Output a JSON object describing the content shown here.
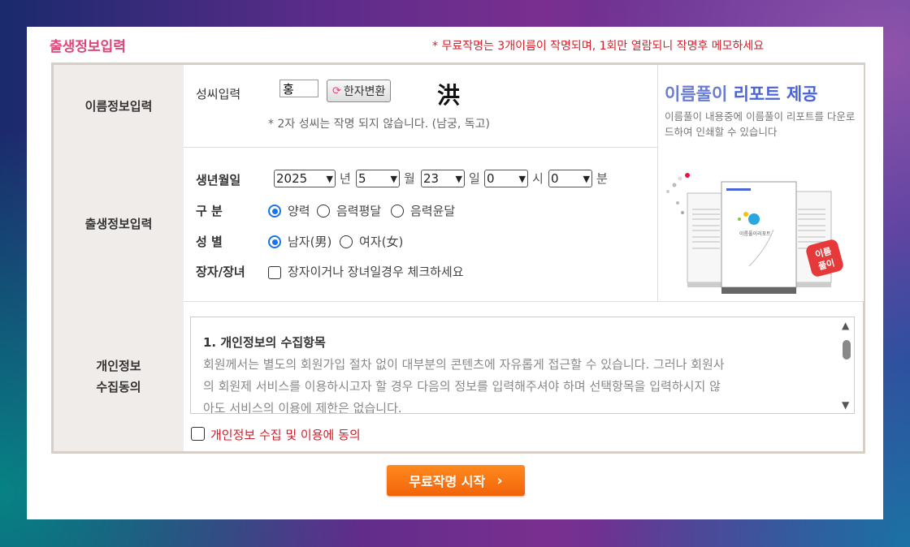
{
  "header": {
    "title": "출생정보입력",
    "note": "* 무료작명는 3개이름이 작명되며, 1회만 열람되니 작명후 메모하세요"
  },
  "name_section": {
    "label": "이름정보입력",
    "surname_label": "성씨입력",
    "surname_value": "홍",
    "hanja_button": "한자변환",
    "hanja_char": "洪",
    "note": "* 2자 성씨는 작명 되지 않습니다. (남궁, 독고)"
  },
  "birth_section": {
    "label": "출생정보입력",
    "date_label": "생년월일",
    "year": "2025",
    "year_unit": "년",
    "month": "5",
    "month_unit": "월",
    "day": "23",
    "day_unit": "일",
    "hour": "0",
    "hour_unit": "시",
    "minute": "0",
    "minute_unit": "분",
    "calendar_label": "구 분",
    "calendar_options": [
      "양력",
      "음력평달",
      "음력윤달"
    ],
    "calendar_selected": "양력",
    "gender_label": "성 별",
    "gender_options": [
      "남자(男)",
      "여자(女)"
    ],
    "gender_selected": "남자(男)",
    "eldest_label": "장자/장녀",
    "eldest_checkbox": "장자이거나 장녀일경우 체크하세요"
  },
  "ad": {
    "title_part1": "이름풀이",
    "title_part2": "리포트 제공",
    "desc": "이름풀이 내용중에 이름풀이 리포트를 다운로드하여 인쇄할 수 있습니다",
    "badge_top": "이름",
    "badge_bottom": "풀이",
    "doc_title": "이름풀이리포트"
  },
  "privacy_section": {
    "label_line1": "개인정보",
    "label_line2": "수집동의",
    "terms_heading": "1. 개인정보의 수집항목",
    "terms_line1": "회원께서는 별도의 회원가입 절차 없이 대부분의 콘텐츠에 자유롭게 접근할 수 있습니다. 그러나 회원사",
    "terms_line2": "의 회원제 서비스를 이용하시고자 할 경우 다음의 정보를 입력해주셔야 하며 선택항목을 입력하시지 않",
    "terms_line3": "아도 서비스의 이용에 제한은 없습니다.",
    "consent_label": "개인정보 수집 및 이용에 동의"
  },
  "start_button": "무료작명 시작"
}
